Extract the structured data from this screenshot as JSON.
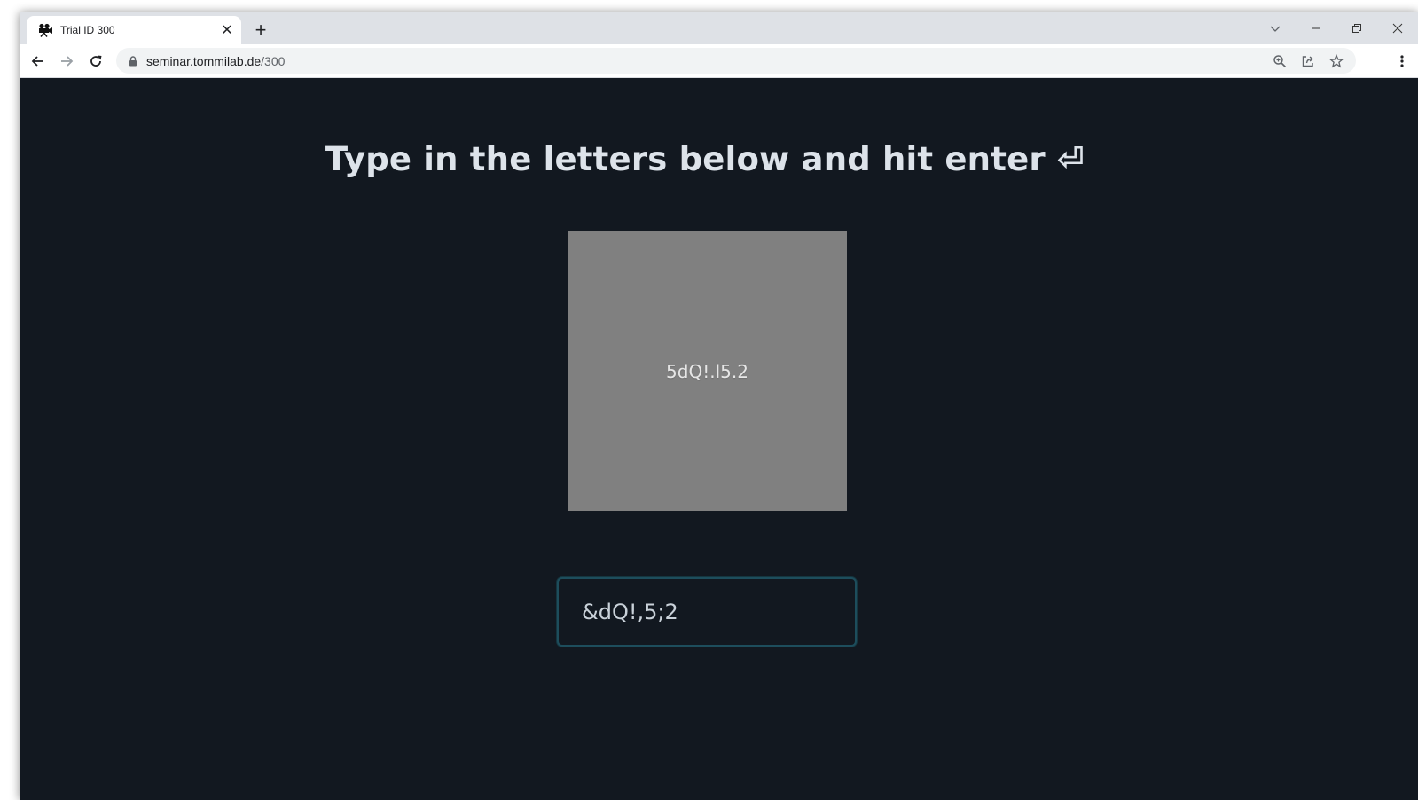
{
  "browser": {
    "tab": {
      "title": "Trial ID 300",
      "favicon": "projector-camera-icon",
      "close_glyph": "✕"
    },
    "new_tab_glyph": "+",
    "window_controls": [
      "tab-search",
      "minimize",
      "restore",
      "close"
    ],
    "url": {
      "host": "seminar.tommilab.de",
      "path": "/300"
    },
    "omnibox_icons": [
      "zoom-icon",
      "share-icon",
      "bookmark-star-icon"
    ]
  },
  "page": {
    "heading": "Type in the letters below and hit enter ⏎",
    "stimulus": {
      "text": "5dQ!.l5.2",
      "background": "#808080"
    },
    "answer": {
      "value": "&dQ!,5;2"
    }
  },
  "colors": {
    "page_background": "#121820",
    "heading_text": "#dde3ea",
    "input_border": "#1d4d5c"
  }
}
